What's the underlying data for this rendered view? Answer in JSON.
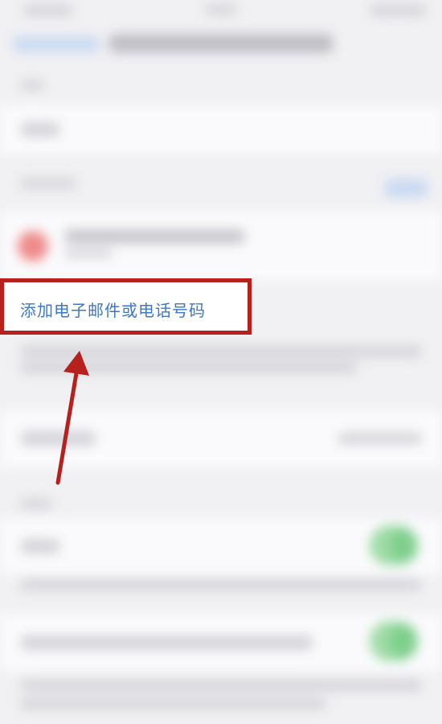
{
  "action_link": {
    "label": "添加电子邮件或电话号码"
  },
  "annotation": {
    "box_color": "#b7211d",
    "arrow_color": "#b7211d"
  },
  "colors": {
    "link": "#3b78c9",
    "toggle_on": "#7fcf8c",
    "avatar": "#f08a8a"
  },
  "icons": {
    "arrow": "annotation-arrow-icon"
  }
}
